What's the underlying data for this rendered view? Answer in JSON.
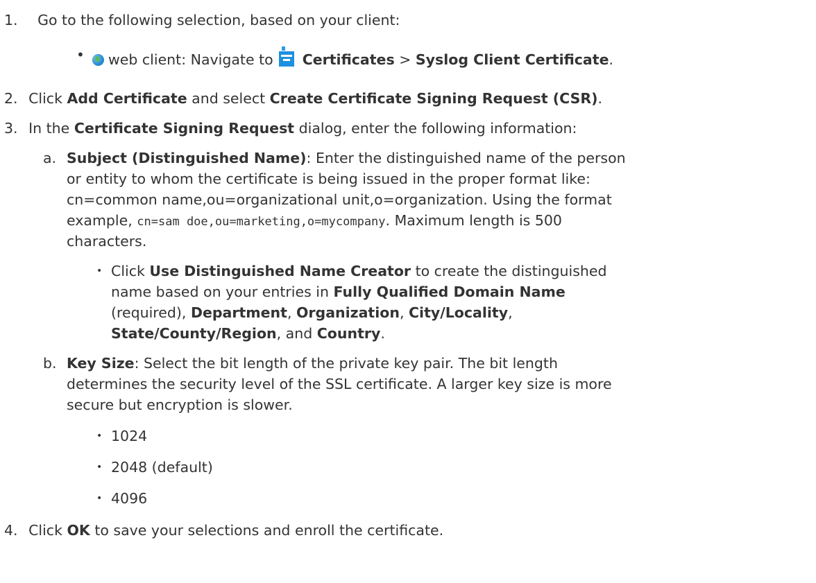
{
  "steps": {
    "s1": {
      "num": "1.",
      "text": "Go to the following selection, based on your client:",
      "bullet": {
        "prefix": "web client: Navigate to",
        "item1": "Certificates",
        "sep": ">",
        "item2": "Syslog Client Certificate",
        "end": "."
      }
    },
    "s2": {
      "num": "2.",
      "t1": "Click",
      "b1": "Add Certificate",
      "t2": "and select",
      "b2": "Create Certificate Signing Request (CSR)",
      "end": "."
    },
    "s3": {
      "num": "3.",
      "t1": "In the",
      "b1": "Certificate Signing Request",
      "t2": "dialog, enter the following information:",
      "a": {
        "label": "a.",
        "title": "Subject (Distinguished Name)",
        "line1": ": Enter the distinguished name of the person",
        "line2": "or entity to whom the certificate is being issued in the proper format like:",
        "line3": "cn=common name,ou=organizational unit,o=organization. Using the format",
        "line4a": "example,",
        "line4code": "cn=sam doe,ou=marketing,o=mycompany",
        "line4b": ". Maximum length is 500",
        "line5": "characters.",
        "sub": {
          "t1": "Click",
          "b1": "Use Distinguished Name Creator",
          "t2": "to create the distinguished",
          "t3": "name based on your entries in",
          "b2": "Fully Qualified Domain Name",
          "t4": "(required),",
          "b3": "Department",
          "c1": ",",
          "b4": "Organization",
          "c2": ",",
          "b5": "City/Locality",
          "c3": ",",
          "b6": "State/County/Region",
          "t5": ", and",
          "b7": "Country",
          "end": "."
        }
      },
      "b": {
        "label": "b.",
        "title": "Key Size",
        "line1": ": Select the bit length of the private key pair. The bit length",
        "line2": "determines the security level of the SSL certificate. A larger key size is more",
        "line3": "secure but encryption is slower.",
        "options": [
          "1024",
          "2048 (default)",
          "4096"
        ]
      }
    },
    "s4": {
      "num": "4.",
      "t1": "Click",
      "b1": "OK",
      "t2": "to save your selections and enroll the certificate."
    }
  },
  "icons": [
    "globe-icon",
    "document-icon"
  ]
}
